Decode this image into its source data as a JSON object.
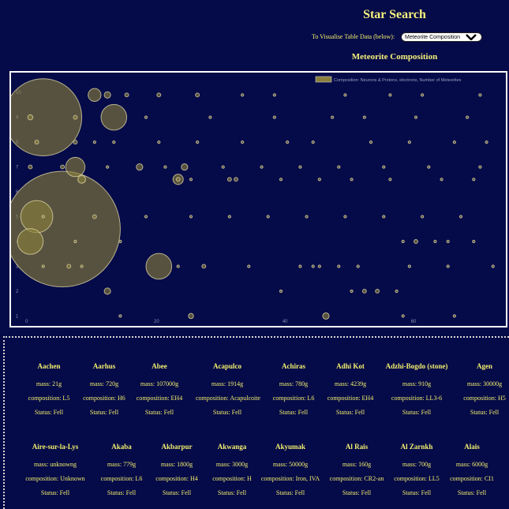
{
  "page": {
    "title": "Star Search",
    "viz_label": "To Visualise Table Data (below):",
    "viz_select_value": "Meteorite Composition",
    "chart_heading": "Meteorite Composition"
  },
  "colors": {
    "background": "#050a48",
    "text": "#f3ef6e",
    "bubble_fill": "#8b7f3c",
    "bubble_stroke": "#d9d2a0"
  },
  "chart_data": {
    "type": "scatter",
    "legend": "Composition: Neurons & Protons, electrons, Number of Meteorites",
    "legend_position": "top-right",
    "xlim": [
      -1,
      76
    ],
    "ylim": [
      0.6,
      10.8
    ],
    "x_ticks": [
      "0",
      "20",
      "40",
      "60"
    ],
    "y_ticks": [
      "1",
      "2",
      "3",
      "4",
      "5",
      "6",
      "7",
      "8",
      "9",
      "10"
    ],
    "points": [
      {
        "x": 4,
        "y": 9,
        "r": 6
      },
      {
        "x": 9,
        "y": 7,
        "r": 1.5
      },
      {
        "x": 12,
        "y": 9.9,
        "r": 1
      },
      {
        "x": 14,
        "y": 9.9,
        "r": 0.5
      },
      {
        "x": 17,
        "y": 9.9,
        "r": 0.3
      },
      {
        "x": 22,
        "y": 9.9,
        "r": 0.3
      },
      {
        "x": 28,
        "y": 9.9,
        "r": 0.3
      },
      {
        "x": 35,
        "y": 9.9,
        "r": 0.2
      },
      {
        "x": 40,
        "y": 9.9,
        "r": 0.2
      },
      {
        "x": 51,
        "y": 9.9,
        "r": 0.2
      },
      {
        "x": 58,
        "y": 9.9,
        "r": 0.2
      },
      {
        "x": 63,
        "y": 9.9,
        "r": 0.2
      },
      {
        "x": 72,
        "y": 9.9,
        "r": 0.2
      },
      {
        "x": 15,
        "y": 9,
        "r": 2
      },
      {
        "x": 2,
        "y": 9,
        "r": 0.4
      },
      {
        "x": 9,
        "y": 9,
        "r": 0.3
      },
      {
        "x": 20,
        "y": 9,
        "r": 0.2
      },
      {
        "x": 30,
        "y": 9,
        "r": 0.2
      },
      {
        "x": 40,
        "y": 9,
        "r": 0.2
      },
      {
        "x": 49,
        "y": 9,
        "r": 0.2
      },
      {
        "x": 54,
        "y": 9,
        "r": 0.2
      },
      {
        "x": 62,
        "y": 9,
        "r": 0.2
      },
      {
        "x": 70,
        "y": 9,
        "r": 0.2
      },
      {
        "x": 3,
        "y": 8,
        "r": 0.3
      },
      {
        "x": 9,
        "y": 8,
        "r": 0.3
      },
      {
        "x": 12,
        "y": 8,
        "r": 0.2
      },
      {
        "x": 15,
        "y": 8,
        "r": 0.2
      },
      {
        "x": 22,
        "y": 8,
        "r": 0.2
      },
      {
        "x": 28,
        "y": 8,
        "r": 0.2
      },
      {
        "x": 35,
        "y": 8,
        "r": 0.2
      },
      {
        "x": 42,
        "y": 8,
        "r": 0.2
      },
      {
        "x": 46,
        "y": 8,
        "r": 0.2
      },
      {
        "x": 55,
        "y": 8,
        "r": 0.2
      },
      {
        "x": 61,
        "y": 8,
        "r": 0.2
      },
      {
        "x": 68,
        "y": 8,
        "r": 0.2
      },
      {
        "x": 73,
        "y": 8,
        "r": 0.2
      },
      {
        "x": 2,
        "y": 7,
        "r": 0.3
      },
      {
        "x": 10,
        "y": 6.5,
        "r": 0.6
      },
      {
        "x": 7,
        "y": 7,
        "r": 0.3
      },
      {
        "x": 14,
        "y": 7,
        "r": 0.2
      },
      {
        "x": 19,
        "y": 7,
        "r": 0.5
      },
      {
        "x": 23,
        "y": 7,
        "r": 0.2
      },
      {
        "x": 26,
        "y": 7,
        "r": 0.5
      },
      {
        "x": 32,
        "y": 7,
        "r": 0.2
      },
      {
        "x": 38,
        "y": 7,
        "r": 0.2
      },
      {
        "x": 44,
        "y": 7,
        "r": 0.2
      },
      {
        "x": 50,
        "y": 7,
        "r": 0.2
      },
      {
        "x": 57,
        "y": 7,
        "r": 0.2
      },
      {
        "x": 64,
        "y": 7,
        "r": 0.2
      },
      {
        "x": 72,
        "y": 7,
        "r": 0.2
      },
      {
        "x": 7,
        "y": 4.5,
        "r": 9
      },
      {
        "x": 3,
        "y": 5,
        "r": 2.5
      },
      {
        "x": 27,
        "y": 6.5,
        "r": 0.2
      },
      {
        "x": 25,
        "y": 6.5,
        "r": 0.3
      },
      {
        "x": 25,
        "y": 6.5,
        "r": 0.8
      },
      {
        "x": 33,
        "y": 6.5,
        "r": 0.3
      },
      {
        "x": 34,
        "y": 6.5,
        "r": 0.3
      },
      {
        "x": 41,
        "y": 6.5,
        "r": 0.2
      },
      {
        "x": 47,
        "y": 6.5,
        "r": 0.2
      },
      {
        "x": 52,
        "y": 6.5,
        "r": 0.2
      },
      {
        "x": 58,
        "y": 6.5,
        "r": 0.2
      },
      {
        "x": 66,
        "y": 6.5,
        "r": 0.2
      },
      {
        "x": 71,
        "y": 6.5,
        "r": 0.2
      },
      {
        "x": 4,
        "y": 5,
        "r": 0.2
      },
      {
        "x": 12,
        "y": 5,
        "r": 0.3
      },
      {
        "x": 20,
        "y": 5,
        "r": 0.2
      },
      {
        "x": 27,
        "y": 5,
        "r": 0.2
      },
      {
        "x": 33,
        "y": 5,
        "r": 0.2
      },
      {
        "x": 39,
        "y": 5,
        "r": 0.2
      },
      {
        "x": 45,
        "y": 5,
        "r": 0.2
      },
      {
        "x": 51,
        "y": 5,
        "r": 0.2
      },
      {
        "x": 57,
        "y": 5,
        "r": 0.2
      },
      {
        "x": 63,
        "y": 5,
        "r": 0.2
      },
      {
        "x": 69,
        "y": 5,
        "r": 0.2
      },
      {
        "x": 2,
        "y": 4,
        "r": 2
      },
      {
        "x": 9,
        "y": 4,
        "r": 0.2
      },
      {
        "x": 16,
        "y": 4,
        "r": 0.2
      },
      {
        "x": 60,
        "y": 4,
        "r": 0.2
      },
      {
        "x": 62,
        "y": 4,
        "r": 0.3
      },
      {
        "x": 65,
        "y": 4,
        "r": 0.2
      },
      {
        "x": 67,
        "y": 4,
        "r": 0.2
      },
      {
        "x": 71,
        "y": 4,
        "r": 0.2
      },
      {
        "x": 22,
        "y": 3,
        "r": 2
      },
      {
        "x": 4,
        "y": 3,
        "r": 0.2
      },
      {
        "x": 8,
        "y": 3,
        "r": 0.3
      },
      {
        "x": 10,
        "y": 3,
        "r": 0.2
      },
      {
        "x": 25,
        "y": 3,
        "r": 0.2
      },
      {
        "x": 29,
        "y": 3,
        "r": 0.3
      },
      {
        "x": 36,
        "y": 3,
        "r": 0.2
      },
      {
        "x": 44,
        "y": 3,
        "r": 0.2
      },
      {
        "x": 46,
        "y": 3,
        "r": 0.2
      },
      {
        "x": 47,
        "y": 3,
        "r": 0.2
      },
      {
        "x": 50,
        "y": 3,
        "r": 0.2
      },
      {
        "x": 53,
        "y": 3,
        "r": 0.2
      },
      {
        "x": 61,
        "y": 3,
        "r": 0.2
      },
      {
        "x": 67,
        "y": 3,
        "r": 0.2
      },
      {
        "x": 74,
        "y": 3,
        "r": 0.2
      },
      {
        "x": 14,
        "y": 2,
        "r": 0.5
      },
      {
        "x": 52,
        "y": 2,
        "r": 0.2
      },
      {
        "x": 54,
        "y": 2,
        "r": 0.3
      },
      {
        "x": 56,
        "y": 2,
        "r": 0.3
      },
      {
        "x": 59,
        "y": 2,
        "r": 0.2
      },
      {
        "x": 41,
        "y": 2,
        "r": 0.2
      },
      {
        "x": 27,
        "y": 1,
        "r": 0.4
      },
      {
        "x": 48,
        "y": 1,
        "r": 0.5
      },
      {
        "x": 16,
        "y": 1,
        "r": 0.2
      },
      {
        "x": 60,
        "y": 1,
        "r": 0.2
      },
      {
        "x": 68,
        "y": 1,
        "r": 0.2
      }
    ]
  },
  "cards": [
    {
      "name": "Aachen",
      "mass": "mass: 21g",
      "composition": "composition: L5",
      "status": "Status: Fell"
    },
    {
      "name": "Aarhus",
      "mass": "mass: 720g",
      "composition": "composition: H6",
      "status": "Status: Fell"
    },
    {
      "name": "Abee",
      "mass": "mass: 107000g",
      "composition": "composition: EH4",
      "status": "Status: Fell"
    },
    {
      "name": "Acapulco",
      "mass": "mass: 1914g",
      "composition": "composition: Acapulcoite",
      "status": "Status: Fell"
    },
    {
      "name": "Achiras",
      "mass": "mass: 780g",
      "composition": "composition: L6",
      "status": "Status: Fell"
    },
    {
      "name": "Adhi Kot",
      "mass": "mass: 4239g",
      "composition": "composition: EH4",
      "status": "Status: Fell"
    },
    {
      "name": "Adzhi-Bogdo (stone)",
      "mass": "mass: 910g",
      "composition": "composition: LL3-6",
      "status": "Status: Fell"
    },
    {
      "name": "Agen",
      "mass": "mass: 30000g",
      "composition": "composition: H5",
      "status": "Status: Fell"
    },
    {
      "name": "Aire-sur-la-Lys",
      "mass": "mass: unknowng",
      "composition": "composition: Unknown",
      "status": "Status: Fell"
    },
    {
      "name": "Akaba",
      "mass": "mass: 779g",
      "composition": "composition: L6",
      "status": "Status: Fell"
    },
    {
      "name": "Akbarpur",
      "mass": "mass: 1800g",
      "composition": "composition: H4",
      "status": "Status: Fell"
    },
    {
      "name": "Akwanga",
      "mass": "mass: 3000g",
      "composition": "composition: H",
      "status": "Status: Fell"
    },
    {
      "name": "Akyumak",
      "mass": "mass: 50000g",
      "composition": "composition: Iron, IVA",
      "status": "Status: Fell"
    },
    {
      "name": "Al Rais",
      "mass": "mass: 160g",
      "composition": "composition: CR2-an",
      "status": "Status: Fell"
    },
    {
      "name": "Al Zarnkh",
      "mass": "mass: 700g",
      "composition": "composition: LL5",
      "status": "Status: Fell"
    },
    {
      "name": "Alais",
      "mass": "mass: 6000g",
      "composition": "composition: CI1",
      "status": "Status: Fell"
    }
  ]
}
